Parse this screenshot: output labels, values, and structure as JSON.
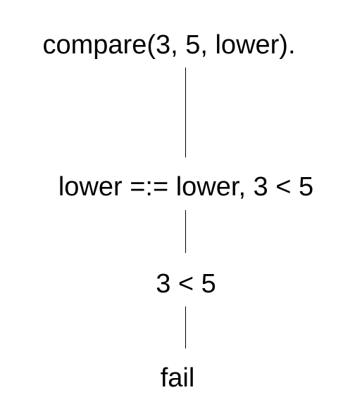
{
  "derivation": {
    "nodes": [
      {
        "label": "compare(3, 5, lower)."
      },
      {
        "label": "lower =:= lower, 3 < 5"
      },
      {
        "label": "3 < 5"
      },
      {
        "label": "fail"
      }
    ],
    "line_color": "#000000",
    "text_color": "#000000"
  }
}
